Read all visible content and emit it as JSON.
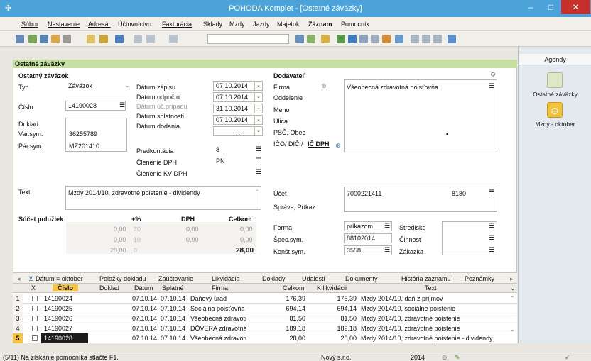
{
  "window": {
    "title": "POHODA Komplet - [Ostatné záväzky]"
  },
  "menu": [
    "Súbor",
    "Nastavenie",
    "Adresár",
    "Účtovníctvo",
    "Fakturácia",
    "Sklady",
    "Mzdy",
    "Jazdy",
    "Majetok",
    "Záznam",
    "Pomocník"
  ],
  "section_title": "Ostatné záväzky",
  "agendy": {
    "title": "Agendy",
    "items": [
      {
        "label": "Ostatné záväzky"
      },
      {
        "label": "Mzdy - október"
      }
    ]
  },
  "form": {
    "zavazok_heading": "Ostatný záväzok",
    "typ_label": "Typ",
    "typ_value": "Záväzok",
    "cislo_label": "Číslo",
    "cislo_value": "14190028",
    "doklad_label": "Doklad",
    "varsym_label": "Var.sym.",
    "varsym_value": "36255789",
    "parsym_label": "Pár.sym.",
    "parsym_value": "MZ201410",
    "datum_zapisu_label": "Dátum zápisu",
    "datum_zapisu": "07.10.2014",
    "datum_odpoctu_label": "Dátum odpočtu",
    "datum_odpoctu": "07.10.2014",
    "datum_uc_label": "Dátum úč.prípadu",
    "datum_uc": "31.10.2014",
    "datum_splatnosti_label": "Dátum splatnosti",
    "datum_splatnosti": "07.10.2014",
    "datum_dodania_label": "Dátum dodania",
    "datum_dodania": ". .",
    "predkontacia_label": "Predkontácia",
    "predkontacia": "8",
    "clenenie_dph_label": "Členenie DPH",
    "clenenie_dph": "PN",
    "clenenie_kv_label": "Členenie KV DPH",
    "dodavatel_heading": "Dodávateľ",
    "firma_label": "Firma",
    "firma_value": "Všeobecná zdravotná poisťovňa",
    "oddelenie_label": "Oddelenie",
    "meno_label": "Meno",
    "ulica_label": "Ulica",
    "psc_label": "PSČ, Obec",
    "ico_label": "IČO/ DIČ /",
    "icdph_label": "IČ DPH",
    "text_label": "Text",
    "text_value": "Mzdy 2014/10, zdravotné poistenie - dividendy",
    "ucet_label": "Účet",
    "ucet_value": "7000221411",
    "ucet_bank": "8180",
    "sprava_label": "Správa, Príkaz",
    "forma_label": "Forma",
    "forma_value": "príkazom",
    "specsym_label": "Špec.sym.",
    "specsym_value": "88102014",
    "konstsym_label": "Konšt.sym.",
    "konstsym_value": "3558",
    "stredisko_label": "Stredisko",
    "cinnost_label": "Činnosť",
    "zakazka_label": "Zákazka"
  },
  "summary": {
    "heading": "Súčet položiek",
    "cols": [
      "+%",
      "DPH",
      "Celkom"
    ],
    "rows": [
      {
        "base": "0,00",
        "pct": "20",
        "dph": "0,00",
        "total": "0,00"
      },
      {
        "base": "0,00",
        "pct": "10",
        "dph": "0,00",
        "total": "0,00"
      },
      {
        "base": "28,00",
        "pct": "0",
        "dph": "",
        "total": "28,00"
      }
    ]
  },
  "tabs": [
    "Dátum = október",
    "Položky dokladu",
    "Zaúčtovanie",
    "Likvidácia",
    "Doklady",
    "Udalosti",
    "Dokumenty",
    "História záznamu",
    "Poznámky"
  ],
  "grid": {
    "columns": [
      "X",
      "Číslo",
      "Doklad",
      "Dátum",
      "Splatné",
      "Firma",
      "Celkom",
      "K likvidácii",
      "Text"
    ],
    "rows": [
      {
        "n": "1",
        "cislo": "14190024",
        "doklad": "",
        "datum": "07.10.14",
        "splatne": "07.10.14",
        "firma": "Daňový úrad",
        "celkom": "176,39",
        "klikv": "176,39",
        "text": "Mzdy 2014/10, daň z príjmov"
      },
      {
        "n": "2",
        "cislo": "14190025",
        "doklad": "",
        "datum": "07.10.14",
        "splatne": "07.10.14",
        "firma": "Sociálna poisťovňa",
        "celkom": "694,14",
        "klikv": "694,14",
        "text": "Mzdy 2014/10, sociálne poistenie"
      },
      {
        "n": "3",
        "cislo": "14190026",
        "doklad": "",
        "datum": "07.10.14",
        "splatne": "07.10.14",
        "firma": "Všeobecná zdravotná",
        "celkom": "81,50",
        "klikv": "81,50",
        "text": "Mzdy 2014/10, zdravotné poistenie"
      },
      {
        "n": "4",
        "cislo": "14190027",
        "doklad": "",
        "datum": "07.10.14",
        "splatne": "07.10.14",
        "firma": "DÔVERA zdravotná p",
        "celkom": "189,18",
        "klikv": "189,18",
        "text": "Mzdy 2014/10, zdravotné poistenie"
      },
      {
        "n": "5",
        "cislo": "14190028",
        "doklad": "",
        "datum": "07.10.14",
        "splatne": "07.10.14",
        "firma": "Všeobecná zdravotná",
        "celkom": "28,00",
        "klikv": "28,00",
        "text": "Mzdy 2014/10, zdravotné poistenie - dividendy"
      }
    ]
  },
  "status": {
    "hint": "(5/11) Na získanie pomocníka stlačte F1.",
    "company": "Nový s.r.o.",
    "year": "2014"
  },
  "colors": {
    "title_bar": "#4ca3d9",
    "section_green": "#c5e0a0",
    "close_red": "#c7312b",
    "selected_row": "#f5c542"
  }
}
